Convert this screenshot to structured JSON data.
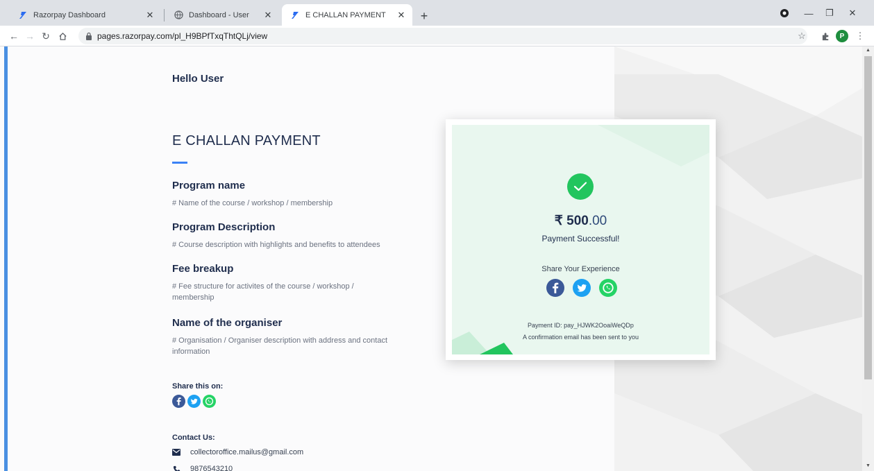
{
  "browser": {
    "tabs": [
      {
        "title": "Razorpay Dashboard",
        "icon": "razorpay-icon"
      },
      {
        "title": "Dashboard - User",
        "icon": "globe-icon"
      },
      {
        "title": "E CHALLAN PAYMENT",
        "icon": "razorpay-icon",
        "active": true
      }
    ],
    "url": "pages.razorpay.com/pl_H9BPfTxqThtQLj/view",
    "profile_initial": "P"
  },
  "page": {
    "greeting": "Hello User",
    "title": "E CHALLAN PAYMENT",
    "sections": [
      {
        "heading": "Program name",
        "text": "# Name of the course / workshop / membership"
      },
      {
        "heading": "Program Description",
        "text": "# Course description with highlights and benefits to attendees"
      },
      {
        "heading": "Fee breakup",
        "text": "# Fee structure for activites of the course / workshop / membership"
      },
      {
        "heading": "Name of the organiser",
        "text": "# Organisation / Organiser description with address and contact information"
      }
    ],
    "share_heading": "Share this on:",
    "contact_heading": "Contact Us:",
    "contact_email": "collectoroffice.mailus@gmail.com",
    "contact_phone": "9876543210"
  },
  "success_card": {
    "currency": "₹",
    "amount_whole": "500",
    "amount_decimal": ".00",
    "status": "Payment Successful!",
    "share_label": "Share Your Experience",
    "payment_id": "Payment ID: pay_HJWK2OoaiWeQDp",
    "confirmation": "A confirmation email has been sent to you"
  },
  "colors": {
    "facebook": "#3b5998",
    "twitter": "#1da1f2",
    "whatsapp": "#25d366",
    "success": "#22c55e",
    "accent": "#3b82f6"
  }
}
